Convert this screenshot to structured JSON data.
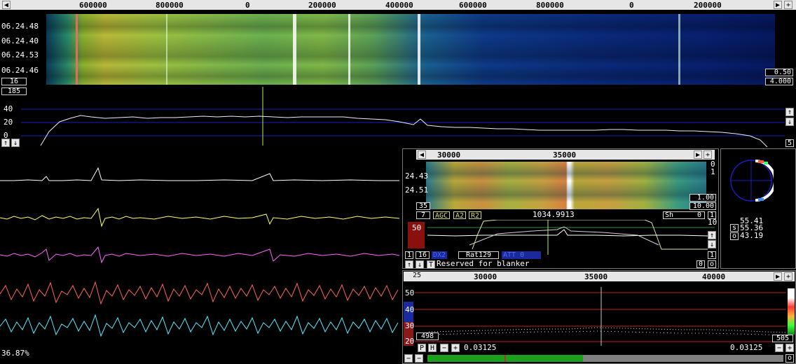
{
  "main_scale": {
    "labels": [
      "600000",
      "800000",
      "0",
      "200000",
      "400000",
      "600000",
      "800000",
      "0",
      "200000"
    ]
  },
  "waterfall": {
    "times": [
      "06.24.48",
      "06.24.40",
      "06.24.53",
      "06.24.46"
    ],
    "avg": "16",
    "gain": "0.50",
    "zero": "4.000"
  },
  "spectrum": {
    "level": "185",
    "y_labels": [
      "40",
      "20",
      "0"
    ],
    "right_value": "5"
  },
  "status": {
    "cpu": "36.87%"
  },
  "baseband": {
    "scale_labels": [
      "30000",
      "35000"
    ],
    "times": [
      "24.43",
      "24.51"
    ],
    "avg": "35",
    "gain": "1.00",
    "zero": "10.00",
    "right_top": "0",
    "right_mid": "1",
    "num_left": "7",
    "tags": {
      "agc": "AGC",
      "a2": "A2",
      "r2": "R2",
      "sh": "Sh",
      "sh_val": "0"
    },
    "freq": "1034.9913",
    "bar_value": "50",
    "right_nums": [
      "1",
      "10",
      "1"
    ],
    "bottom": {
      "n1": "1",
      "n16": "16",
      "rat": "Rat129",
      "t": "T",
      "blank": "Reserved for blanker",
      "o": "0"
    },
    "blue_tags": [
      "DX2",
      "ATT 0"
    ]
  },
  "smeter": {
    "s": "55.41",
    "mid": "55.36",
    "o": "43.19",
    "s_lbl": "s",
    "o_lbl": "o"
  },
  "hires": {
    "num": "25",
    "scale_labels": [
      "30000",
      "35000",
      "40000"
    ],
    "y_labels": [
      "50",
      "40",
      "30",
      "20"
    ],
    "left_val": "498",
    "right_val": "505",
    "p": "P",
    "h": "H",
    "bw_left": "0.03125",
    "bw_right": "0.03125",
    "o": "o"
  },
  "colors": {
    "accent": "#d7d774",
    "graph_bg": "#000000",
    "spectrum_line": "#ffffff",
    "grid": "#1c1cc0"
  }
}
